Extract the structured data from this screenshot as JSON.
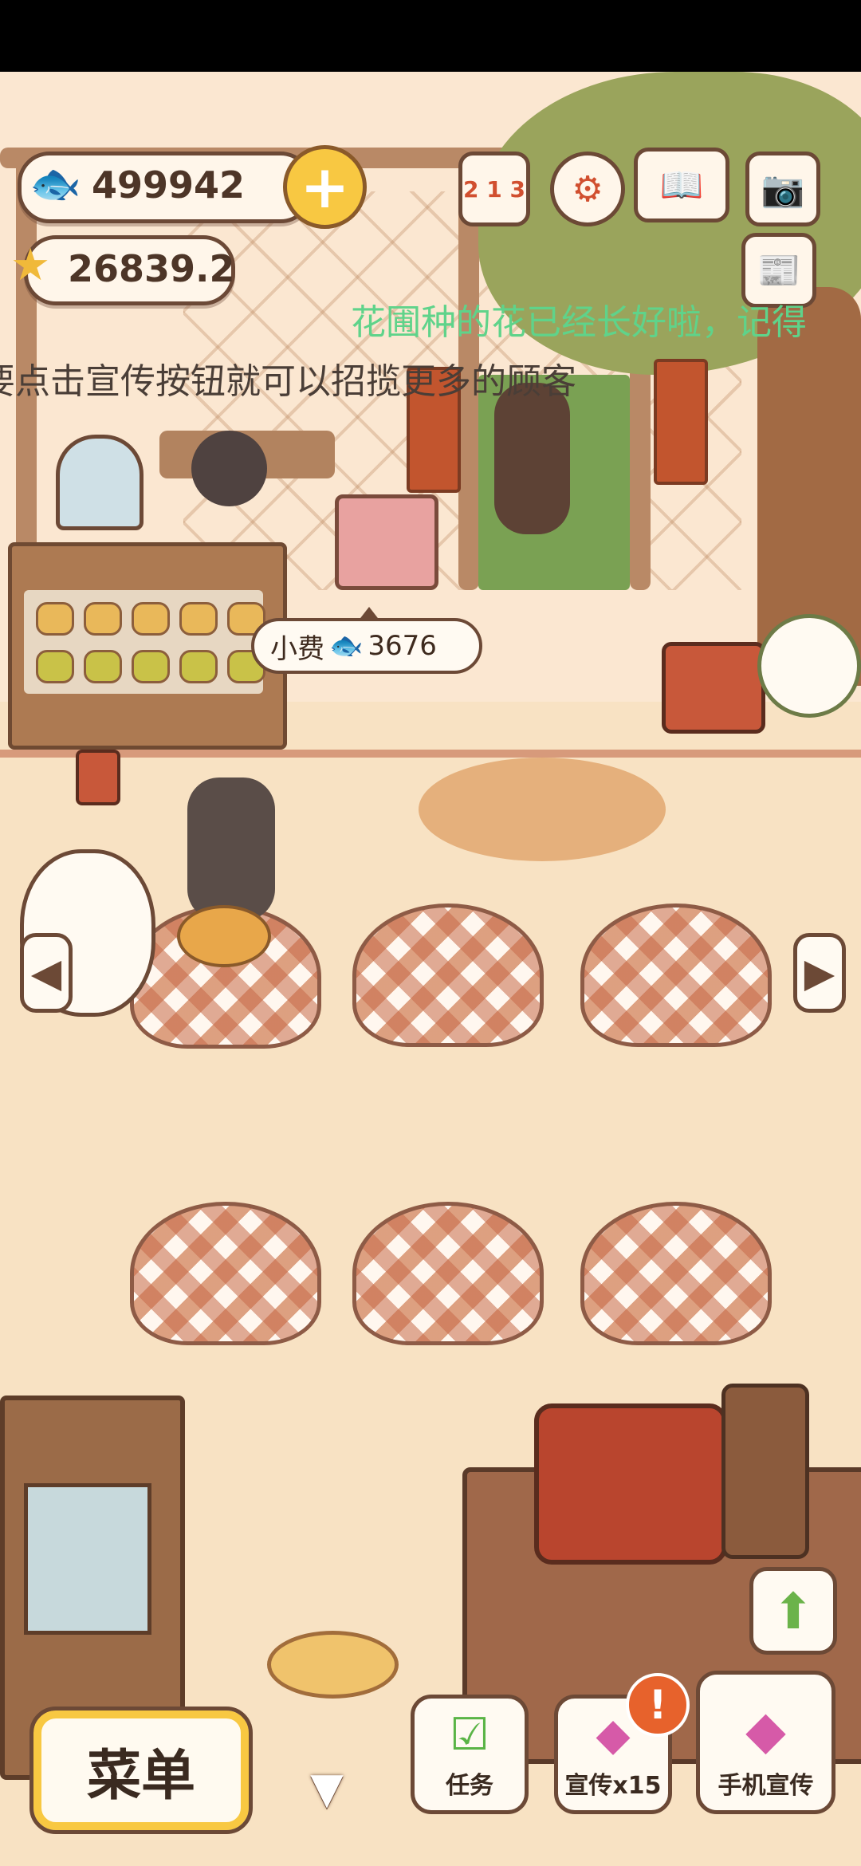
{
  "hud": {
    "fish_count": "499942",
    "star_count": "26839.2",
    "fish_icon": "fish-icon",
    "star_icon": "star-icon",
    "plus_label": "+"
  },
  "top_icons": [
    {
      "name": "ranking-icon",
      "glyph": "2 1 3"
    },
    {
      "name": "gear-icon",
      "glyph": "⚙"
    },
    {
      "name": "recipe-book-icon",
      "glyph": "📖"
    },
    {
      "name": "camera-icon",
      "glyph": "📷"
    },
    {
      "name": "newspaper-icon",
      "glyph": "📰"
    }
  ],
  "marquee": {
    "line1": "花圃种的花已经长好啦，记得",
    "line2": "要点击宣传按钮就可以招揽更多的顾客",
    "line1_color": "#5fd38a",
    "line2_color": "#4a3e37"
  },
  "tip_bubble": {
    "label": "小费",
    "amount": "3676"
  },
  "nav": {
    "left_arrow": "◀",
    "right_arrow": "▶",
    "down_arrow": "▼",
    "up_arrow": "⬆"
  },
  "bottom_bar": {
    "menu_label": "菜单",
    "task_label": "任务",
    "promo_label": "宣传x15",
    "phone_promo_label": "手机宣传",
    "alert_badge": "!"
  },
  "colors": {
    "accent_yellow": "#f8c842",
    "outline_brown": "#6c4936",
    "floor": "#f8e2c3",
    "alert_orange": "#e7622c"
  }
}
